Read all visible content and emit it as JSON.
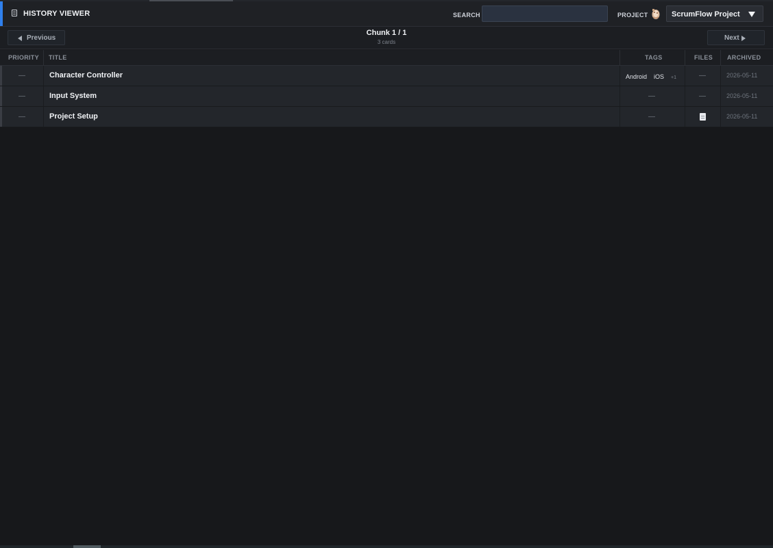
{
  "header": {
    "title": "HISTORY VIEWER",
    "search_label": "SEARCH",
    "search_value": "",
    "search_placeholder": "",
    "project_label": "PROJECT",
    "project_value": "ScrumFlow Project"
  },
  "pager": {
    "previous_label": "Previous",
    "next_label": "Next",
    "chunk_label": "Chunk  1  /  1",
    "cards_count": "3 cards"
  },
  "table": {
    "columns": {
      "priority": "PRIORITY",
      "title": "TITLE",
      "tags": "TAGS",
      "files": "FILES",
      "archived": "ARCHIVED"
    },
    "rows": [
      {
        "priority": "—",
        "title": "Character Controller",
        "tags": [
          "Android",
          "iOS"
        ],
        "tags_more": "+1",
        "files": "—",
        "archived": "2026-05-11"
      },
      {
        "priority": "—",
        "title": "Input System",
        "tags_empty": "—",
        "files": "—",
        "archived": "2026-05-11"
      },
      {
        "priority": "—",
        "title": "Project Setup",
        "tags_empty": "—",
        "files_icon": "document-icon",
        "archived": "2026-05-11"
      }
    ]
  },
  "colors": {
    "accent": "#2f80ed",
    "background": "#17181b",
    "row_background": "#23262b"
  }
}
